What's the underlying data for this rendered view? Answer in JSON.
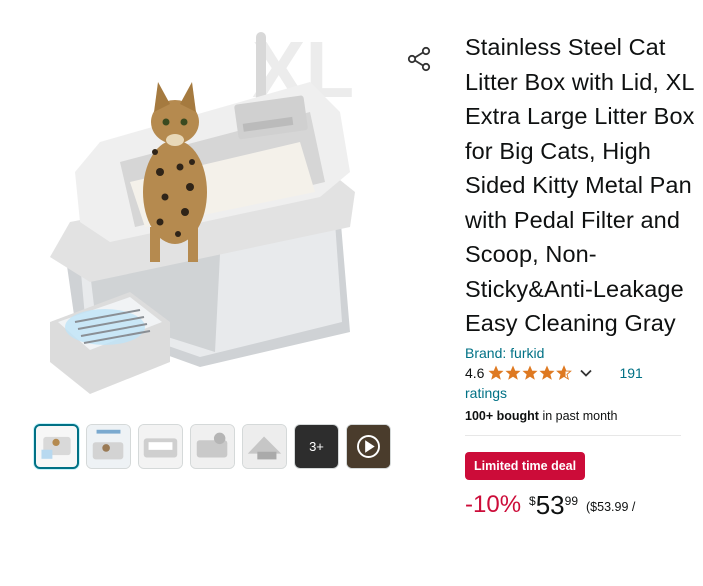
{
  "product": {
    "title": "Stainless Steel Cat Litter Box with Lid, XL Extra Large Litter Box for Big Cats, High Sided Kitty Metal Pan with Pedal Filter and Scoop, Non-Sticky&Anti-Leakage Easy Cleaning Gray",
    "brand": "Brand: furkid",
    "rating_value": "4.6",
    "rating_fraction": 0.92,
    "rating_count": "191",
    "ratings_word": "ratings",
    "bought_bold": "100+ bought",
    "bought_rest": " in past month",
    "deal_badge": "Limited time deal",
    "discount": "-10%",
    "currency": "$",
    "price_whole": "53",
    "price_fraction": "99",
    "unit_price": "($53.99 /"
  },
  "gallery": {
    "watermark": "XL",
    "more_label": "3+",
    "thumbnail_count": 7
  },
  "icons": {
    "share": "share-icon",
    "star": "star-icon",
    "chevron": "chevron-down-icon",
    "play": "play-icon"
  },
  "colors": {
    "link": "#007185",
    "deal": "#cc0c39",
    "star": "#de7921",
    "text": "#0f1111"
  }
}
